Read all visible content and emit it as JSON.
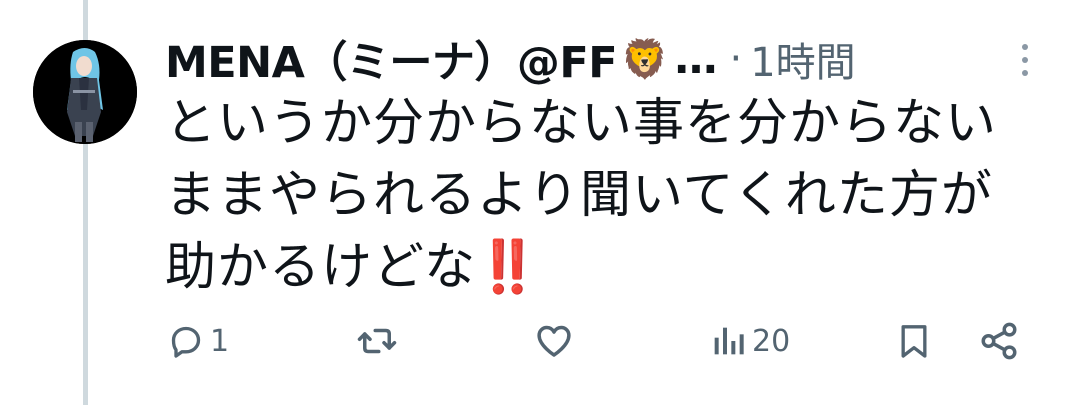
{
  "tweet": {
    "author": {
      "display_name": "MENA（ミーナ）@FF",
      "name_emoji": "🦁",
      "truncation": "…",
      "separator": "·",
      "timestamp": "1時間"
    },
    "text_lines": [
      "というか分からない事を分からない",
      "ままやられるより聞いてくれた方が",
      "助かるけどな"
    ],
    "text_emoji": "‼️",
    "actions": {
      "reply_count": "1",
      "retweet_count": "",
      "like_count": "",
      "views_count": "20"
    }
  },
  "colors": {
    "text_primary": "#0f1419",
    "text_secondary": "#536471",
    "thread_line": "#cfd9de",
    "exclamation": "#e2202a"
  },
  "icons": {
    "reply": "reply-icon",
    "retweet": "retweet-icon",
    "like": "heart-icon",
    "views": "views-icon",
    "bookmark": "bookmark-icon",
    "share": "share-icon",
    "more": "more-vertical-icon"
  }
}
